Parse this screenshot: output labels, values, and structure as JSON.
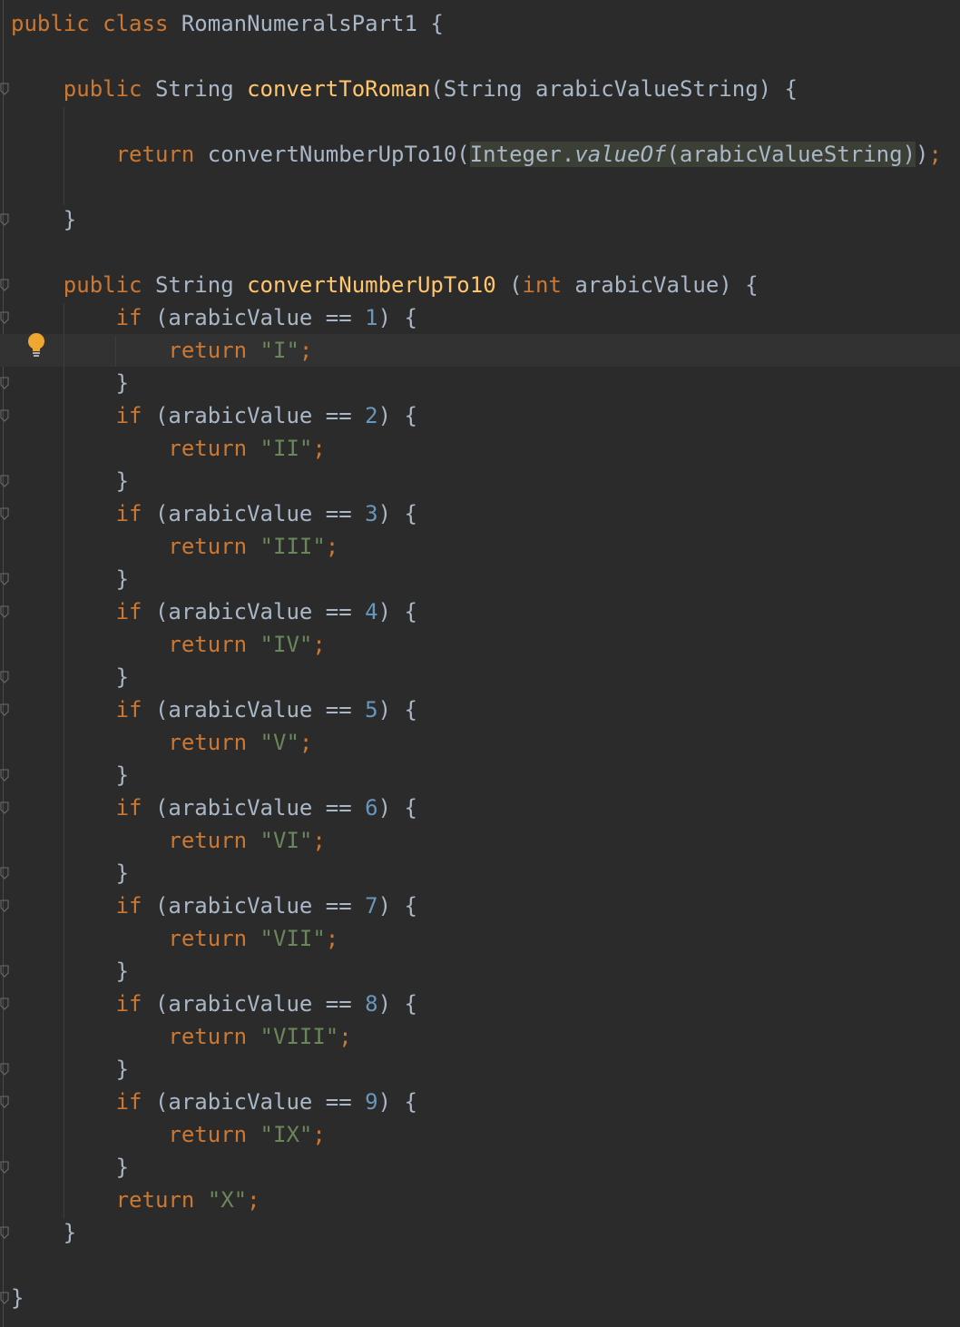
{
  "code": {
    "language": "java",
    "class_name": "RomanNumeralsPart1",
    "lines": [
      {
        "tokens": [
          {
            "t": "public class ",
            "c": "kw"
          },
          {
            "t": "RomanNumeralsPart1 {",
            "c": "plain"
          }
        ]
      },
      {
        "tokens": []
      },
      {
        "tokens": [
          {
            "t": "    "
          },
          {
            "t": "public ",
            "c": "kw"
          },
          {
            "t": "String "
          },
          {
            "t": "convertToRoman",
            "c": "fn"
          },
          {
            "t": "(String arabicValueString) {"
          }
        ]
      },
      {
        "tokens": []
      },
      {
        "tokens": [
          {
            "t": "        "
          },
          {
            "t": "return ",
            "c": "kw"
          },
          {
            "t": "convertNumberUpTo10("
          },
          {
            "t": "Integer.",
            "c": "hl"
          },
          {
            "t": "valueOf",
            "c": "hl italic"
          },
          {
            "t": "(arabicValueString)",
            "c": "hl"
          },
          {
            "t": ")"
          },
          {
            "t": ";",
            "c": "kw"
          }
        ]
      },
      {
        "tokens": []
      },
      {
        "tokens": [
          {
            "t": "    }"
          }
        ]
      },
      {
        "tokens": []
      },
      {
        "tokens": [
          {
            "t": "    "
          },
          {
            "t": "public ",
            "c": "kw"
          },
          {
            "t": "String "
          },
          {
            "t": "convertNumberUpTo10 ",
            "c": "fn"
          },
          {
            "t": "("
          },
          {
            "t": "int ",
            "c": "kw"
          },
          {
            "t": "arabicValue) {"
          }
        ]
      },
      {
        "tokens": [
          {
            "t": "        "
          },
          {
            "t": "if ",
            "c": "kw"
          },
          {
            "t": "(arabicValue == "
          },
          {
            "t": "1",
            "c": "num"
          },
          {
            "t": ") {"
          }
        ]
      },
      {
        "tokens": [
          {
            "t": "            "
          },
          {
            "t": "return ",
            "c": "kw"
          },
          {
            "t": "\"I\"",
            "c": "str"
          },
          {
            "t": ";",
            "c": "kw"
          }
        ]
      },
      {
        "tokens": [
          {
            "t": "        }"
          }
        ]
      },
      {
        "tokens": [
          {
            "t": "        "
          },
          {
            "t": "if ",
            "c": "kw"
          },
          {
            "t": "(arabicValue == "
          },
          {
            "t": "2",
            "c": "num"
          },
          {
            "t": ") {"
          }
        ]
      },
      {
        "tokens": [
          {
            "t": "            "
          },
          {
            "t": "return ",
            "c": "kw"
          },
          {
            "t": "\"II\"",
            "c": "str"
          },
          {
            "t": ";",
            "c": "kw"
          }
        ]
      },
      {
        "tokens": [
          {
            "t": "        }"
          }
        ]
      },
      {
        "tokens": [
          {
            "t": "        "
          },
          {
            "t": "if ",
            "c": "kw"
          },
          {
            "t": "(arabicValue == "
          },
          {
            "t": "3",
            "c": "num"
          },
          {
            "t": ") {"
          }
        ]
      },
      {
        "tokens": [
          {
            "t": "            "
          },
          {
            "t": "return ",
            "c": "kw"
          },
          {
            "t": "\"III\"",
            "c": "str"
          },
          {
            "t": ";",
            "c": "kw"
          }
        ]
      },
      {
        "tokens": [
          {
            "t": "        }"
          }
        ]
      },
      {
        "tokens": [
          {
            "t": "        "
          },
          {
            "t": "if ",
            "c": "kw"
          },
          {
            "t": "(arabicValue == "
          },
          {
            "t": "4",
            "c": "num"
          },
          {
            "t": ") {"
          }
        ]
      },
      {
        "tokens": [
          {
            "t": "            "
          },
          {
            "t": "return ",
            "c": "kw"
          },
          {
            "t": "\"IV\"",
            "c": "str"
          },
          {
            "t": ";",
            "c": "kw"
          }
        ]
      },
      {
        "tokens": [
          {
            "t": "        }"
          }
        ]
      },
      {
        "tokens": [
          {
            "t": "        "
          },
          {
            "t": "if ",
            "c": "kw"
          },
          {
            "t": "(arabicValue == "
          },
          {
            "t": "5",
            "c": "num"
          },
          {
            "t": ") {"
          }
        ]
      },
      {
        "tokens": [
          {
            "t": "            "
          },
          {
            "t": "return ",
            "c": "kw"
          },
          {
            "t": "\"V\"",
            "c": "str"
          },
          {
            "t": ";",
            "c": "kw"
          }
        ]
      },
      {
        "tokens": [
          {
            "t": "        }"
          }
        ]
      },
      {
        "tokens": [
          {
            "t": "        "
          },
          {
            "t": "if ",
            "c": "kw"
          },
          {
            "t": "(arabicValue == "
          },
          {
            "t": "6",
            "c": "num"
          },
          {
            "t": ") {"
          }
        ]
      },
      {
        "tokens": [
          {
            "t": "            "
          },
          {
            "t": "return ",
            "c": "kw"
          },
          {
            "t": "\"VI\"",
            "c": "str"
          },
          {
            "t": ";",
            "c": "kw"
          }
        ]
      },
      {
        "tokens": [
          {
            "t": "        }"
          }
        ]
      },
      {
        "tokens": [
          {
            "t": "        "
          },
          {
            "t": "if ",
            "c": "kw"
          },
          {
            "t": "(arabicValue == "
          },
          {
            "t": "7",
            "c": "num"
          },
          {
            "t": ") {"
          }
        ]
      },
      {
        "tokens": [
          {
            "t": "            "
          },
          {
            "t": "return ",
            "c": "kw"
          },
          {
            "t": "\"VII\"",
            "c": "str"
          },
          {
            "t": ";",
            "c": "kw"
          }
        ]
      },
      {
        "tokens": [
          {
            "t": "        }"
          }
        ]
      },
      {
        "tokens": [
          {
            "t": "        "
          },
          {
            "t": "if ",
            "c": "kw"
          },
          {
            "t": "(arabicValue == "
          },
          {
            "t": "8",
            "c": "num"
          },
          {
            "t": ") {"
          }
        ]
      },
      {
        "tokens": [
          {
            "t": "            "
          },
          {
            "t": "return ",
            "c": "kw"
          },
          {
            "t": "\"VIII\"",
            "c": "str"
          },
          {
            "t": ";",
            "c": "kw"
          }
        ]
      },
      {
        "tokens": [
          {
            "t": "        }"
          }
        ]
      },
      {
        "tokens": [
          {
            "t": "        "
          },
          {
            "t": "if ",
            "c": "kw"
          },
          {
            "t": "(arabicValue == "
          },
          {
            "t": "9",
            "c": "num"
          },
          {
            "t": ") {"
          }
        ]
      },
      {
        "tokens": [
          {
            "t": "            "
          },
          {
            "t": "return ",
            "c": "kw"
          },
          {
            "t": "\"IX\"",
            "c": "str"
          },
          {
            "t": ";",
            "c": "kw"
          }
        ]
      },
      {
        "tokens": [
          {
            "t": "        }"
          }
        ]
      },
      {
        "tokens": [
          {
            "t": "        "
          },
          {
            "t": "return ",
            "c": "kw"
          },
          {
            "t": "\"X\"",
            "c": "str"
          },
          {
            "t": ";",
            "c": "kw"
          }
        ]
      },
      {
        "tokens": [
          {
            "t": "    }"
          }
        ]
      },
      {
        "tokens": []
      },
      {
        "tokens": [
          {
            "t": "}"
          }
        ]
      }
    ]
  },
  "gutter": {
    "intention_icon": "lightbulb-icon",
    "fold_icon": "fold-marker-icon"
  },
  "colors": {
    "background": "#2b2b2b",
    "keyword": "#cc7832",
    "function": "#ffc66d",
    "number": "#6897bb",
    "string": "#6a8759",
    "plain": "#a9b7c6",
    "highlight": "#3b3f35",
    "bulb": "#f0a732"
  }
}
